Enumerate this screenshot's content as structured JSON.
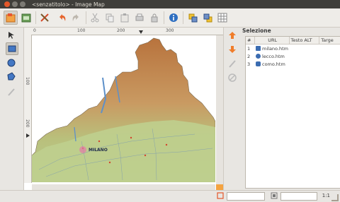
{
  "window": {
    "title": "<senzatitolo> - Image Map"
  },
  "toolbar": {
    "icons": [
      "new-image-icon",
      "open-image-icon",
      "tools-icon",
      "undo-icon",
      "redo-icon",
      "cut-icon",
      "copy-icon",
      "paste-icon",
      "print-icon",
      "lock-icon",
      "info-icon",
      "bring-front-icon",
      "send-back-icon",
      "grid-icon"
    ]
  },
  "ruler": {
    "top_labels": [
      "0",
      "100",
      "200",
      "300"
    ],
    "left_labels": [
      "100",
      "200"
    ]
  },
  "panel": {
    "title": "Selezione",
    "columns": [
      "#",
      "URL",
      "Testo ALT",
      "Targe"
    ],
    "rows": [
      {
        "num": "1",
        "url": "milano.htm"
      },
      {
        "num": "2",
        "url": "lecco.htm"
      },
      {
        "num": "3",
        "url": "como.htm"
      }
    ]
  },
  "map": {
    "city_label": "MILANO"
  },
  "status": {
    "zoom": "1:1"
  }
}
